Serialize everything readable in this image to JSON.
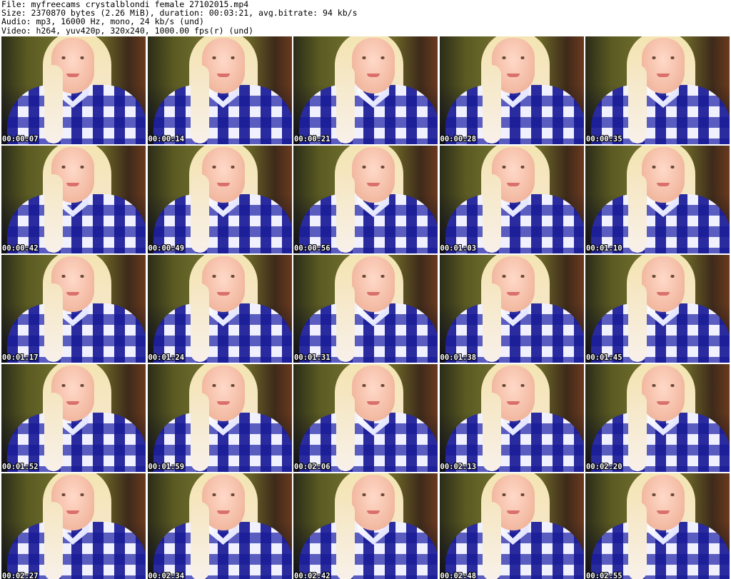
{
  "header": {
    "file_line": "File: myfreecams_crystalblondi_female_27102015.mp4",
    "size_line": "Size: 2370870 bytes (2.26 MiB), duration: 00:03:21, avg.bitrate: 94 kb/s",
    "audio_line": "Audio: mp3, 16000 Hz, mono, 24 kb/s (und)",
    "video_line": "Video: h264, yuv420p, 320x240, 1000.00 fps(r) (und)"
  },
  "frames": [
    {
      "timestamp": "00:00:07"
    },
    {
      "timestamp": "00:00:14"
    },
    {
      "timestamp": "00:00:21"
    },
    {
      "timestamp": "00:00:28"
    },
    {
      "timestamp": "00:00:35"
    },
    {
      "timestamp": "00:00:42"
    },
    {
      "timestamp": "00:00:49"
    },
    {
      "timestamp": "00:00:56"
    },
    {
      "timestamp": "00:01:03"
    },
    {
      "timestamp": "00:01:10"
    },
    {
      "timestamp": "00:01:17"
    },
    {
      "timestamp": "00:01:24"
    },
    {
      "timestamp": "00:01:31"
    },
    {
      "timestamp": "00:01:38"
    },
    {
      "timestamp": "00:01:45"
    },
    {
      "timestamp": "00:01:52"
    },
    {
      "timestamp": "00:01:59"
    },
    {
      "timestamp": "00:02:06"
    },
    {
      "timestamp": "00:02:13"
    },
    {
      "timestamp": "00:02:20"
    },
    {
      "timestamp": "00:02:27"
    },
    {
      "timestamp": "00:02:34"
    },
    {
      "timestamp": "00:02:42"
    },
    {
      "timestamp": "00:02:48"
    },
    {
      "timestamp": "00:02:55"
    }
  ]
}
